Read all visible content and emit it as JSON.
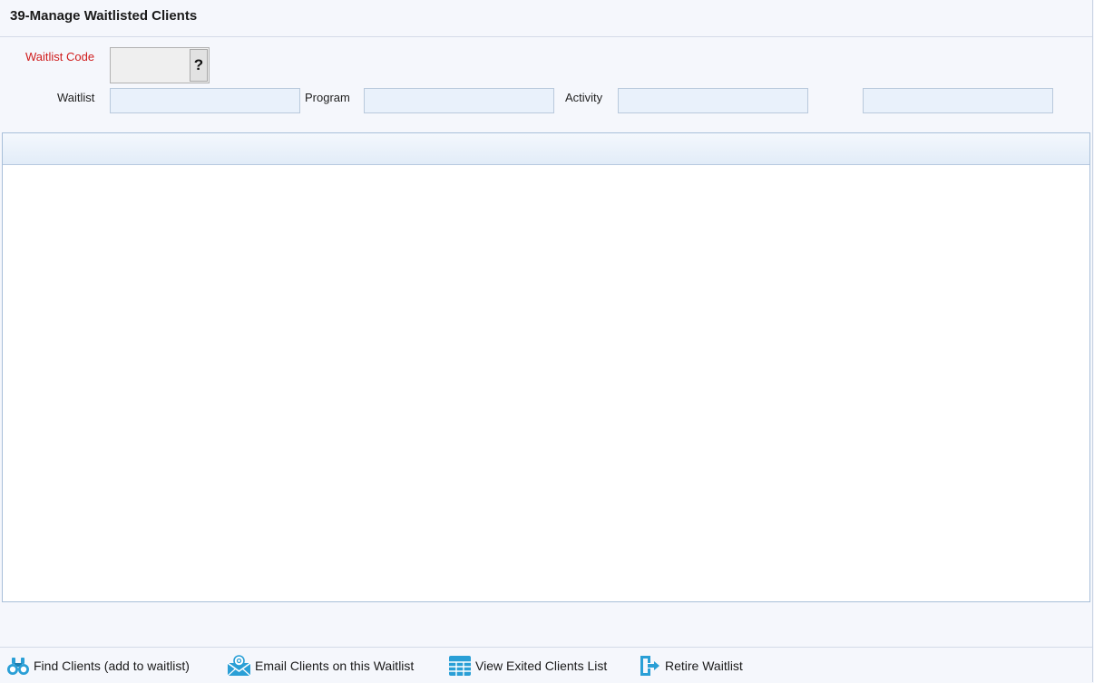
{
  "header": {
    "title": "39-Manage Waitlisted Clients"
  },
  "form": {
    "waitlist_code_label": "Waitlist Code",
    "waitlist_code_value": "",
    "lookup_label": "?",
    "waitlist_label": "Waitlist",
    "waitlist_value": "",
    "program_label": "Program",
    "program_value": "",
    "activity_label": "Activity",
    "activity_value": "",
    "extra_value": ""
  },
  "toolbar": {
    "find_clients": {
      "label": "Find Clients (add to waitlist)",
      "icon": "binoculars-icon"
    },
    "email_clients": {
      "label": "Email Clients on this Waitlist",
      "icon": "envelope-at-icon"
    },
    "view_exited": {
      "label": "View Exited Clients List",
      "icon": "table-grid-icon"
    },
    "retire": {
      "label": "Retire Waitlist",
      "icon": "exit-door-icon"
    }
  },
  "colors": {
    "required_label": "#d01c1c",
    "field_bg": "#e9f1fb",
    "field_border": "#b9c9dc",
    "icon_blue": "#2a9fd6"
  }
}
